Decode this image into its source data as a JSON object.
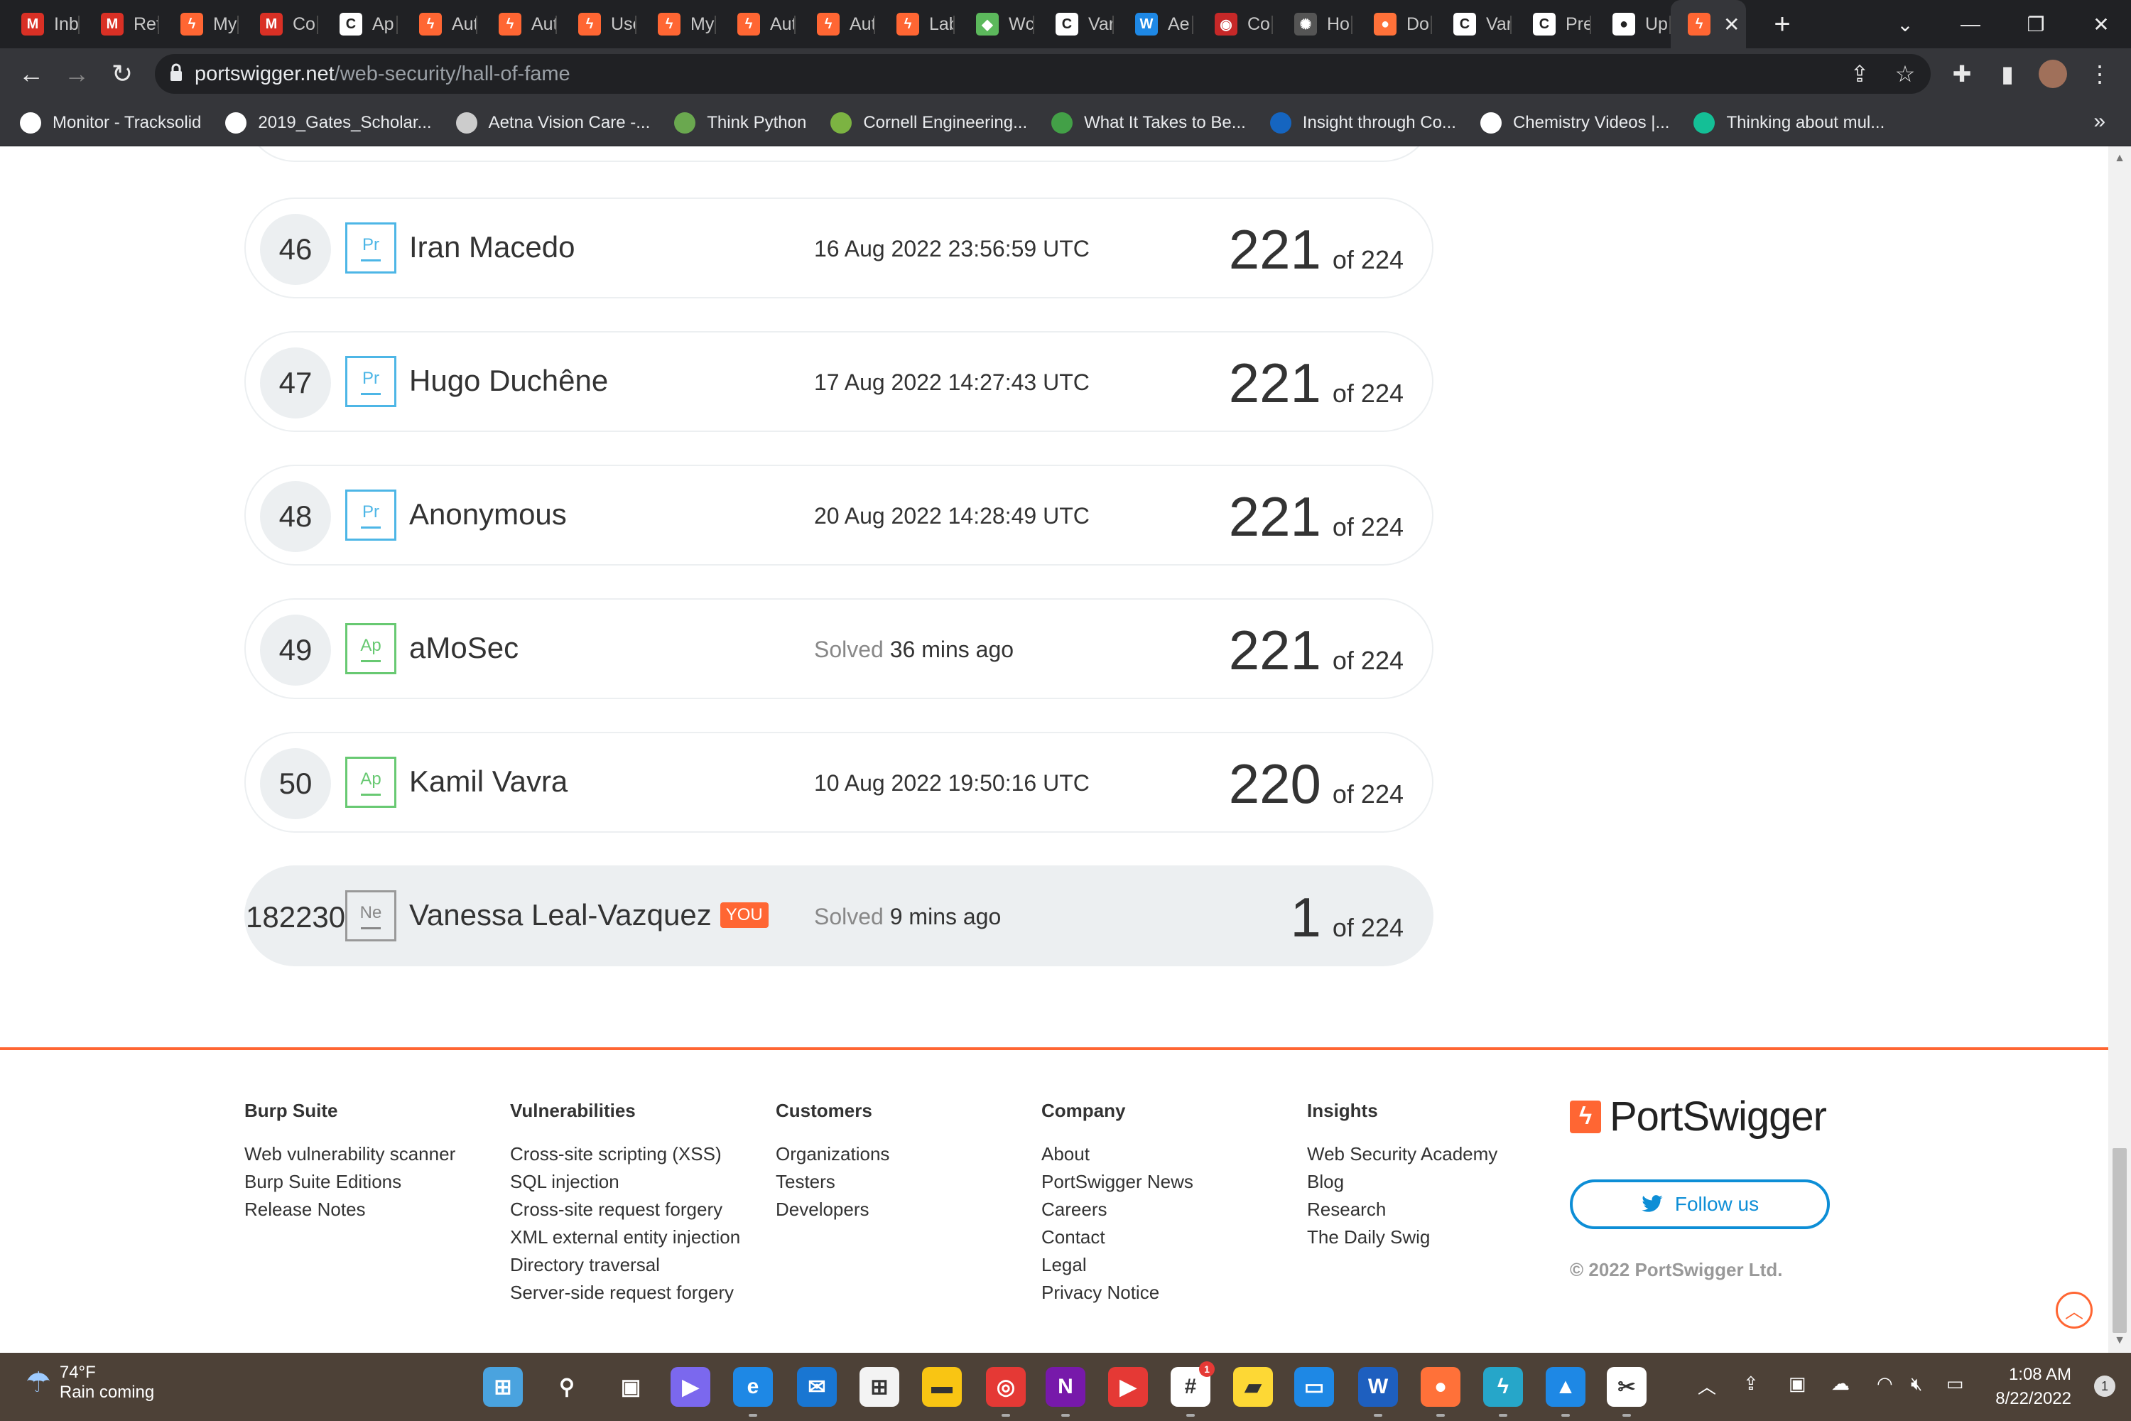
{
  "browser": {
    "tabs": [
      {
        "label": "Inb",
        "icon": "gmail-icon",
        "color": "#d93025",
        "glyph": "M"
      },
      {
        "label": "Ret",
        "icon": "gmail-icon",
        "color": "#d93025",
        "glyph": "M"
      },
      {
        "label": "My",
        "icon": "portswigger-icon",
        "color": "#ff6633",
        "glyph": "ϟ"
      },
      {
        "label": "Co",
        "icon": "gmail-icon",
        "color": "#d93025",
        "glyph": "M"
      },
      {
        "label": "Ap",
        "icon": "c-icon",
        "color": "#ffffff",
        "glyph": "C"
      },
      {
        "label": "Aut",
        "icon": "portswigger-icon",
        "color": "#ff6633",
        "glyph": "ϟ"
      },
      {
        "label": "Aut",
        "icon": "portswigger-icon",
        "color": "#ff6633",
        "glyph": "ϟ"
      },
      {
        "label": "Use",
        "icon": "portswigger-icon",
        "color": "#ff6633",
        "glyph": "ϟ"
      },
      {
        "label": "My",
        "icon": "portswigger-icon",
        "color": "#ff6633",
        "glyph": "ϟ"
      },
      {
        "label": "Aut",
        "icon": "portswigger-icon",
        "color": "#ff6633",
        "glyph": "ϟ"
      },
      {
        "label": "Aut",
        "icon": "portswigger-icon",
        "color": "#ff6633",
        "glyph": "ϟ"
      },
      {
        "label": "Lab",
        "icon": "portswigger-icon",
        "color": "#ff6633",
        "glyph": "ϟ"
      },
      {
        "label": "Wc",
        "icon": "leaf-icon",
        "color": "#5cb85c",
        "glyph": "◆"
      },
      {
        "label": "Var",
        "icon": "c-icon",
        "color": "#ffffff",
        "glyph": "C"
      },
      {
        "label": "Ae",
        "icon": "w-icon",
        "color": "#1e88e5",
        "glyph": "W"
      },
      {
        "label": "Co",
        "icon": "shield-icon",
        "color": "#c62828",
        "glyph": "◉"
      },
      {
        "label": "Ho",
        "icon": "gear-icon",
        "color": "#555555",
        "glyph": "✺"
      },
      {
        "label": "Do",
        "icon": "firefox-icon",
        "color": "#ff7139",
        "glyph": "●"
      },
      {
        "label": "Var",
        "icon": "c-icon",
        "color": "#ffffff",
        "glyph": "C"
      },
      {
        "label": "Pre",
        "icon": "c-icon",
        "color": "#ffffff",
        "glyph": "C"
      },
      {
        "label": "Up",
        "icon": "github-icon",
        "color": "#ffffff",
        "glyph": "●"
      }
    ],
    "active_tab_icon": "portswigger-icon",
    "url_host": "portswigger.net",
    "url_path": "/web-security/hall-of-fame",
    "bookmarks": [
      {
        "label": "Monitor - Tracksolid",
        "icon": "globe-icon",
        "color": "#ffffff"
      },
      {
        "label": "2019_Gates_Scholar...",
        "icon": "globe-icon",
        "color": "#ffffff"
      },
      {
        "label": "Aetna Vision Care -...",
        "icon": "eye-icon",
        "color": "#cccccc"
      },
      {
        "label": "Think Python",
        "icon": "sprout-icon",
        "color": "#6aa84f"
      },
      {
        "label": "Cornell Engineering...",
        "icon": "grid-icon",
        "color": "#7cb342"
      },
      {
        "label": "What It Takes to Be...",
        "icon": "robot-icon",
        "color": "#43a047"
      },
      {
        "label": "Insight through Co...",
        "icon": "flag-icon",
        "color": "#1565c0"
      },
      {
        "label": "Chemistry Videos |...",
        "icon": "globe-icon",
        "color": "#ffffff"
      },
      {
        "label": "Thinking about mul...",
        "icon": "khan-icon",
        "color": "#14bf96"
      }
    ]
  },
  "leaderboard": [
    {
      "rank": "46",
      "level": "Pr",
      "level_kind": "pr",
      "name": "Iran Macedo",
      "date_prefix": "",
      "date": "16 Aug 2022 23:56:59 UTC",
      "score": "221",
      "of": "of 224",
      "you": ""
    },
    {
      "rank": "47",
      "level": "Pr",
      "level_kind": "pr",
      "name": "Hugo Duchêne",
      "date_prefix": "",
      "date": "17 Aug 2022 14:27:43 UTC",
      "score": "221",
      "of": "of 224",
      "you": ""
    },
    {
      "rank": "48",
      "level": "Pr",
      "level_kind": "pr",
      "name": "Anonymous",
      "date_prefix": "",
      "date": "20 Aug 2022 14:28:49 UTC",
      "score": "221",
      "of": "of 224",
      "you": ""
    },
    {
      "rank": "49",
      "level": "Ap",
      "level_kind": "ap",
      "name": "aMoSec",
      "date_prefix": "Solved",
      "date": "36 mins ago",
      "score": "221",
      "of": "of 224",
      "you": ""
    },
    {
      "rank": "50",
      "level": "Ap",
      "level_kind": "ap",
      "name": "Kamil Vavra",
      "date_prefix": "",
      "date": "10 Aug 2022 19:50:16 UTC",
      "score": "220",
      "of": "of 224",
      "you": ""
    },
    {
      "rank": "182230",
      "level": "Ne",
      "level_kind": "ne",
      "name": "Vanessa Leal-Vazquez",
      "date_prefix": "Solved",
      "date": "9 mins ago",
      "score": "1",
      "of": "of 224",
      "you": "YOU"
    }
  ],
  "footer": {
    "columns": [
      {
        "title": "Burp Suite",
        "links": [
          "Web vulnerability scanner",
          "Burp Suite Editions",
          "Release Notes"
        ]
      },
      {
        "title": "Vulnerabilities",
        "links": [
          "Cross-site scripting (XSS)",
          "SQL injection",
          "Cross-site request forgery",
          "XML external entity injection",
          "Directory traversal",
          "Server-side request forgery"
        ]
      },
      {
        "title": "Customers",
        "links": [
          "Organizations",
          "Testers",
          "Developers"
        ]
      },
      {
        "title": "Company",
        "links": [
          "About",
          "PortSwigger News",
          "Careers",
          "Contact",
          "Legal",
          "Privacy Notice"
        ]
      },
      {
        "title": "Insights",
        "links": [
          "Web Security Academy",
          "Blog",
          "Research",
          "The Daily Swig"
        ]
      }
    ],
    "logo_text": "PortSwigger",
    "follow_label": "Follow us",
    "copyright": "© 2022 PortSwigger Ltd.",
    "accent_color": "#ff6633"
  },
  "taskbar": {
    "temperature": "74°F",
    "weather": "Rain coming",
    "apps": [
      {
        "icon": "windows-start-icon",
        "color": "#4aa3df",
        "glyph": "⊞",
        "running": false
      },
      {
        "icon": "search-icon",
        "color": "transparent",
        "glyph": "⚲",
        "running": false
      },
      {
        "icon": "task-view-icon",
        "color": "transparent",
        "glyph": "▣",
        "running": false
      },
      {
        "icon": "teams-chat-icon",
        "color": "#7b68ee",
        "glyph": "▶",
        "running": false
      },
      {
        "icon": "edge-icon",
        "color": "#1e88e5",
        "glyph": "e",
        "running": true
      },
      {
        "icon": "mail-icon",
        "color": "#1976d2",
        "glyph": "✉",
        "running": false
      },
      {
        "icon": "store-icon",
        "color": "#f3f3f3",
        "glyph": "⊞",
        "running": false
      },
      {
        "icon": "file-explorer-icon",
        "color": "#f9c513",
        "glyph": "▬",
        "running": false
      },
      {
        "icon": "chrome-icon",
        "color": "#e53935",
        "glyph": "◎",
        "running": true
      },
      {
        "icon": "onenote-icon",
        "color": "#7719aa",
        "glyph": "N",
        "running": true
      },
      {
        "icon": "youtube-music-icon",
        "color": "#e53935",
        "glyph": "▶",
        "running": false
      },
      {
        "icon": "slack-icon",
        "color": "#ffffff",
        "glyph": "#",
        "running": true
      },
      {
        "icon": "sticky-notes-icon",
        "color": "#fdd835",
        "glyph": "▰",
        "running": false
      },
      {
        "icon": "remote-desktop-icon",
        "color": "#1e88e5",
        "glyph": "▭",
        "running": false
      },
      {
        "icon": "word-icon",
        "color": "#1e5fbf",
        "glyph": "W",
        "running": true
      },
      {
        "icon": "firefox-icon",
        "color": "#ff7139",
        "glyph": "●",
        "running": true
      },
      {
        "icon": "burp-suite-icon",
        "color": "#26a6c9",
        "glyph": "ϟ",
        "running": true
      },
      {
        "icon": "photos-icon",
        "color": "#1e88e5",
        "glyph": "▲",
        "running": true
      },
      {
        "icon": "snipping-tool-icon",
        "color": "#ffffff",
        "glyph": "✂",
        "running": true
      }
    ],
    "slack_badge": "1",
    "time": "1:08 AM",
    "date": "8/22/2022",
    "notifications": "1"
  }
}
